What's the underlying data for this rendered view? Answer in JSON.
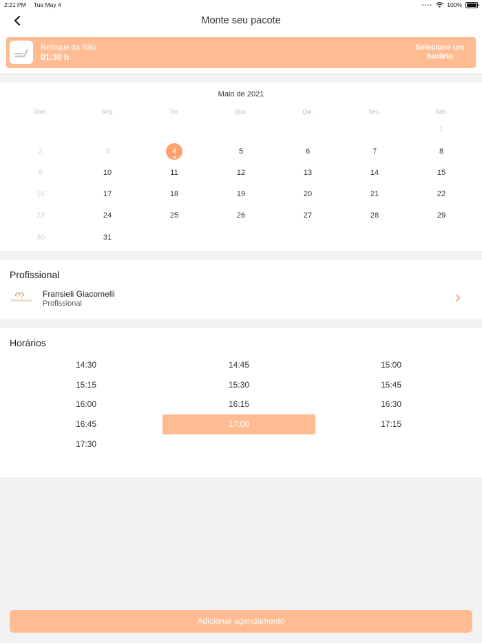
{
  "status_bar": {
    "time": "2:21 PM",
    "date": "Tue May 4",
    "battery": "100%"
  },
  "nav": {
    "title": "Monte seu pacote",
    "back_icon": "chevron-left-icon"
  },
  "service": {
    "name": "Retoque da Raiz",
    "duration": "01:30 h",
    "select_label_line1": "Selecione um",
    "select_label_line2": "horário",
    "icon": "chair-icon"
  },
  "calendar": {
    "month": "Maio de 2021",
    "weekdays": [
      "Dom.",
      "Seg.",
      "Ter.",
      "Qua.",
      "Qui.",
      "Sex.",
      "Sáb."
    ],
    "weeks": [
      [
        null,
        null,
        null,
        null,
        null,
        null,
        {
          "d": "1",
          "disabled": true
        }
      ],
      [
        {
          "d": "2",
          "disabled": true
        },
        {
          "d": "3",
          "disabled": true
        },
        {
          "d": "4",
          "selected": true
        },
        {
          "d": "5"
        },
        {
          "d": "6"
        },
        {
          "d": "7"
        },
        {
          "d": "8"
        }
      ],
      [
        {
          "d": "9",
          "disabled": true
        },
        {
          "d": "10"
        },
        {
          "d": "11"
        },
        {
          "d": "12"
        },
        {
          "d": "13"
        },
        {
          "d": "14"
        },
        {
          "d": "15"
        }
      ],
      [
        {
          "d": "16",
          "disabled": true
        },
        {
          "d": "17"
        },
        {
          "d": "18"
        },
        {
          "d": "19"
        },
        {
          "d": "20"
        },
        {
          "d": "21"
        },
        {
          "d": "22"
        }
      ],
      [
        {
          "d": "23",
          "disabled": true
        },
        {
          "d": "24"
        },
        {
          "d": "25"
        },
        {
          "d": "26"
        },
        {
          "d": "27"
        },
        {
          "d": "28"
        },
        {
          "d": "29"
        }
      ],
      [
        {
          "d": "30",
          "disabled": true
        },
        {
          "d": "31"
        },
        null,
        null,
        null,
        null,
        null
      ]
    ]
  },
  "professional": {
    "section_title": "Profissional",
    "name": "Fransieli Giacomelli",
    "role": "Profissional"
  },
  "times": {
    "section_title": "Horários",
    "slots": [
      "14:30",
      "14:45",
      "15:00",
      "15:15",
      "15:30",
      "15:45",
      "16:00",
      "16:15",
      "16:30",
      "16:45",
      "17:00",
      "17:15",
      "17:30"
    ],
    "selected": "17:00"
  },
  "add_button": {
    "label": "Adicionar agendamento"
  },
  "colors": {
    "accent": "#ffbb92",
    "accent_strong": "#ffa06e",
    "background": "#f2f2f2"
  }
}
